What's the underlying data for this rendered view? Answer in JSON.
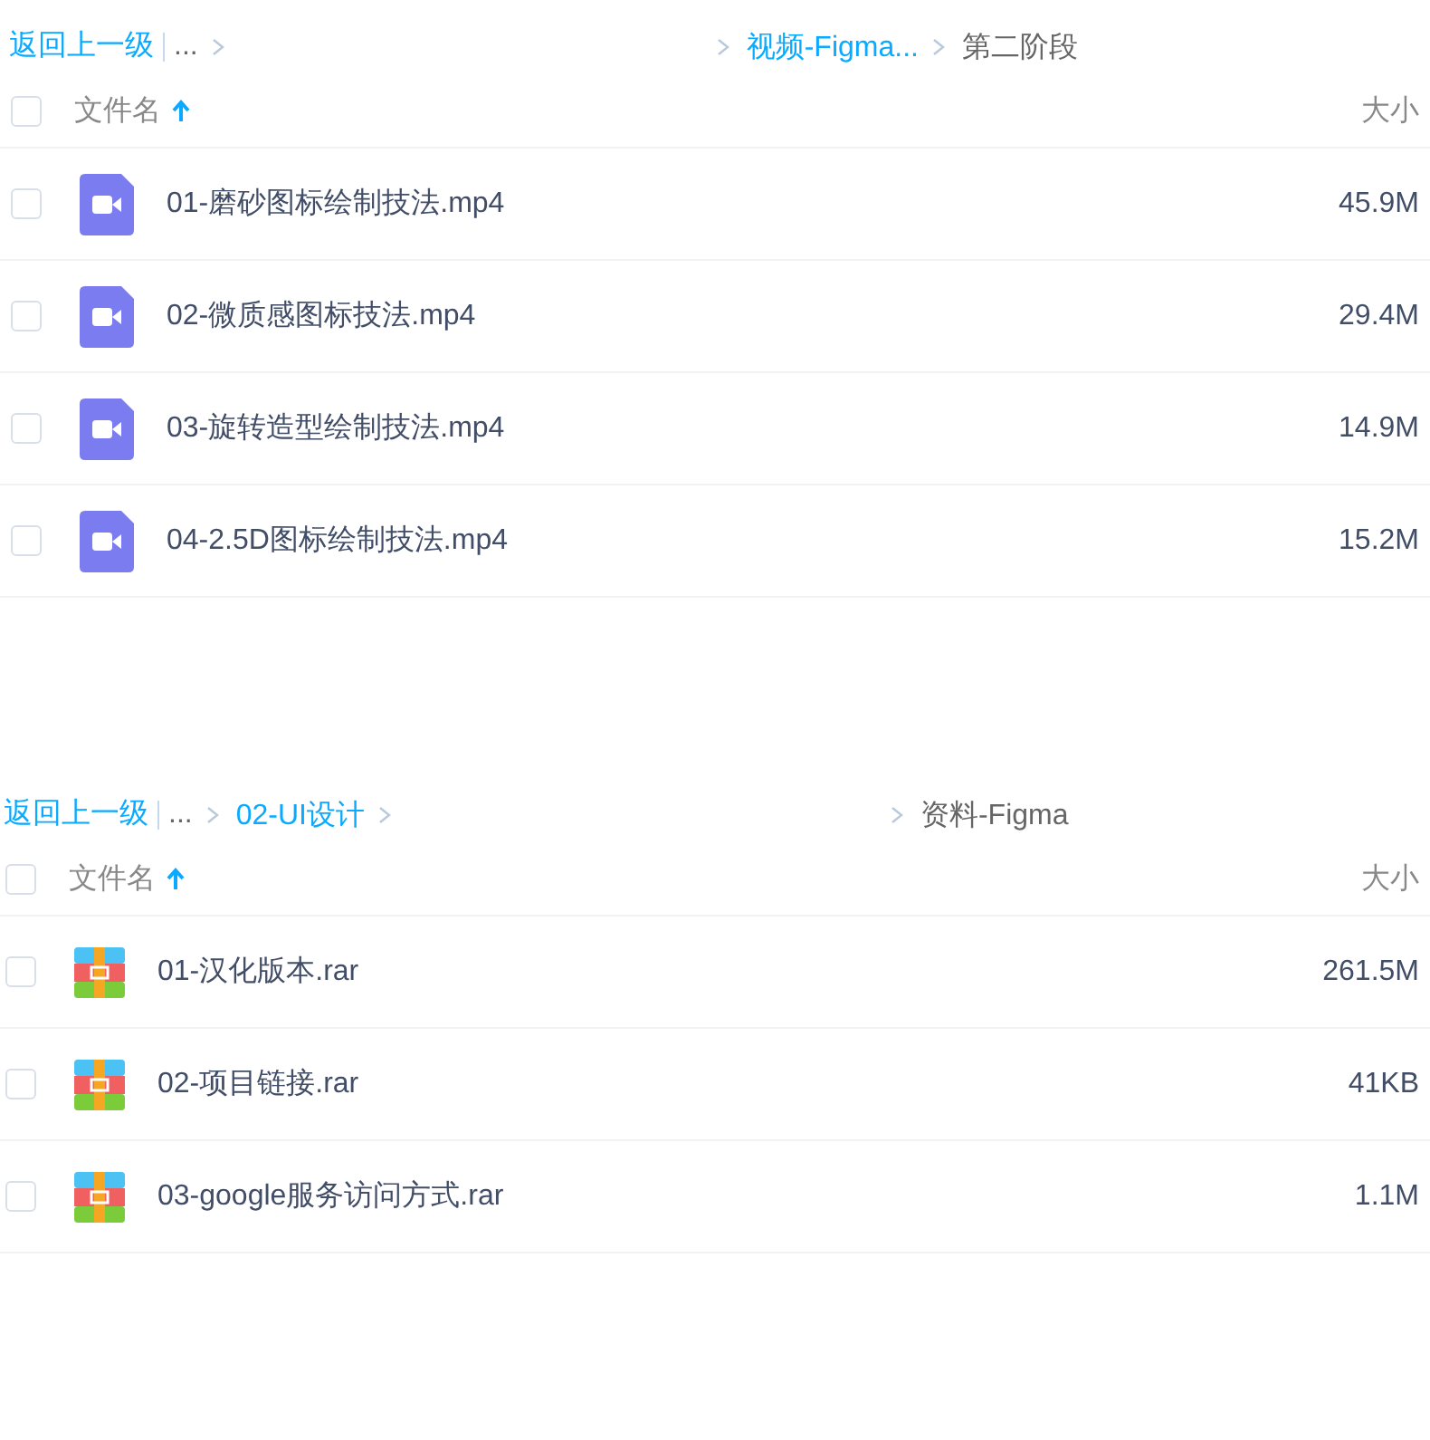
{
  "panels": [
    {
      "breadcrumb": {
        "back": "返回上一级",
        "ellipsis": "...",
        "right_links": [
          "视频-Figma..."
        ],
        "current": "第二阶段"
      },
      "header": {
        "checked": false,
        "name": "文件名",
        "size": "大小"
      },
      "files": [
        {
          "kind": "video",
          "name": "01-磨砂图标绘制技法.mp4",
          "size": "45.9M",
          "checked": false
        },
        {
          "kind": "video",
          "name": "02-微质感图标技法.mp4",
          "size": "29.4M",
          "checked": false
        },
        {
          "kind": "video",
          "name": "03-旋转造型绘制技法.mp4",
          "size": "14.9M",
          "checked": false
        },
        {
          "kind": "video",
          "name": "04-2.5D图标绘制技法.mp4",
          "size": "15.2M",
          "checked": false
        }
      ]
    },
    {
      "breadcrumb": {
        "back": "返回上一级",
        "ellipsis": "...",
        "left_links": [
          "02-UI设计"
        ],
        "current": "资料-Figma"
      },
      "header": {
        "checked": false,
        "name": "文件名",
        "size": "大小"
      },
      "files": [
        {
          "kind": "archive",
          "name": "01-汉化版本.rar",
          "size": "261.5M",
          "checked": false
        },
        {
          "kind": "archive",
          "name": "02-项目链接.rar",
          "size": "41KB",
          "checked": false
        },
        {
          "kind": "archive",
          "name": "03-google服务访问方式.rar",
          "size": "1.1M",
          "checked": false
        }
      ]
    }
  ]
}
